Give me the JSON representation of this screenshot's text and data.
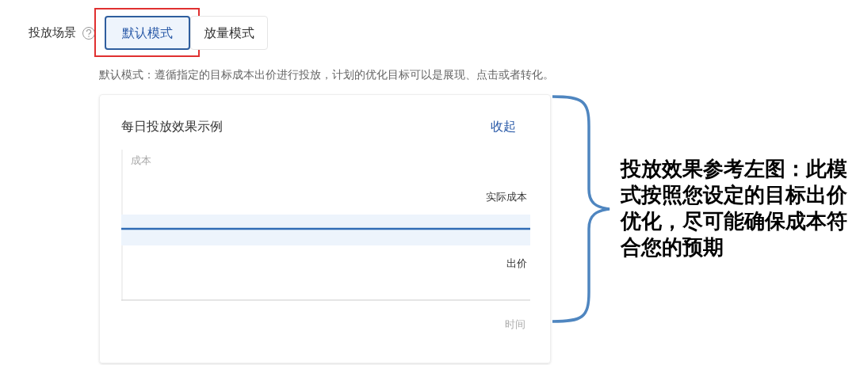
{
  "field": {
    "label": "投放场景",
    "options": [
      {
        "label": "默认模式",
        "selected": true
      },
      {
        "label": "放量模式",
        "selected": false
      }
    ],
    "description": "默认模式：遵循指定的目标成本出价进行投放，计划的优化目标可以是展现、点击或者转化。"
  },
  "example_card": {
    "title": "每日投放效果示例",
    "collapse_link": "收起",
    "y_axis_label": "成本",
    "actual_cost_label": "实际成本",
    "bid_label": "出价",
    "x_axis_label": "时间"
  },
  "annotation": {
    "text": "投放效果参考左图：此模式按照您设定的目标出价优化，尽可能确保成本符合您的预期"
  }
}
